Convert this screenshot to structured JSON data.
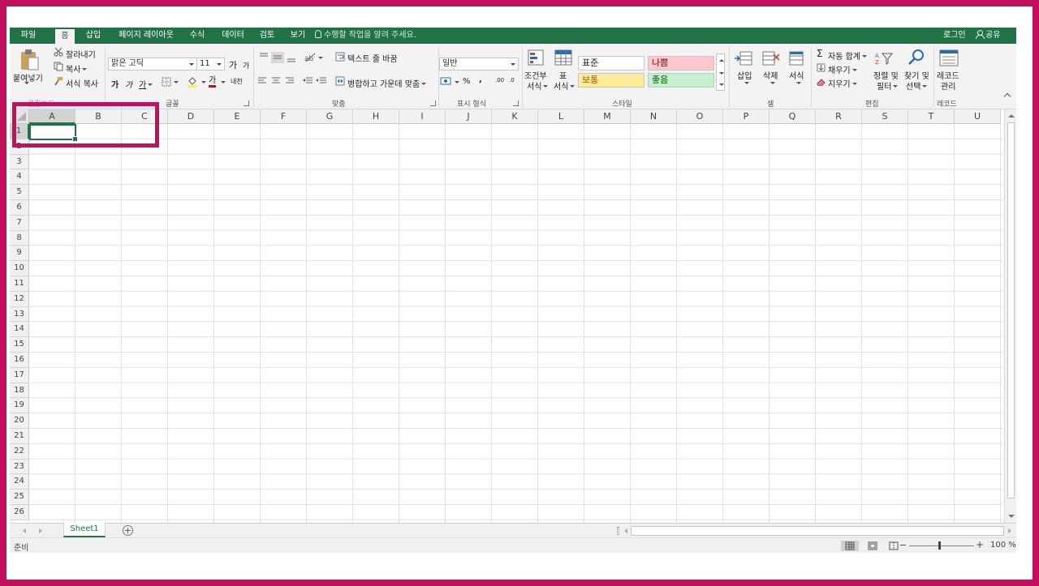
{
  "tabs": {
    "file": "파일",
    "home": "홈",
    "insert": "삽입",
    "layout": "페이지 레이아웃",
    "formulas": "수식",
    "data": "데이터",
    "review": "검토",
    "view": "보기",
    "tell_me": "수행할 작업을 알려 주세요.",
    "login": "로그인",
    "share": "공유"
  },
  "clipboard": {
    "paste": "붙여넣기",
    "cut": "잘라내기",
    "copy": "복사",
    "format_painter": "서식 복사",
    "label": "클립보드"
  },
  "font": {
    "name": "맑은 고딕",
    "size": "11",
    "grow": "가",
    "shrink": "가",
    "bold": "가",
    "italic": "가",
    "underline": "가",
    "color_letter": "가",
    "phonetic": "내천",
    "label": "글꼴"
  },
  "alignment": {
    "wrap_text": "텍스트 줄 바꿈",
    "merge_center": "병합하고 가운데 맞춤",
    "label": "맞춤"
  },
  "number": {
    "format": "일반",
    "percent": "%",
    "comma": ",",
    "inc_dec": ".00",
    "dec_dec": ".0",
    "label": "표시 형식"
  },
  "styles": {
    "conditional_1": "조건부",
    "conditional_2": "서식",
    "table_1": "표",
    "table_2": "서식",
    "normal": "표준",
    "bad": "나쁨",
    "neutral": "보통",
    "good": "좋음",
    "label": "스타일"
  },
  "cells": {
    "insert": "삽입",
    "delete": "삭제",
    "format": "서식",
    "label": "셀"
  },
  "editing": {
    "autosum": "자동 합계",
    "fill": "채우기",
    "clear": "지우기",
    "sort_1": "정렬 및",
    "sort_2": "필터",
    "find_1": "찾기 및",
    "find_2": "선택",
    "label": "편집"
  },
  "records": {
    "btn_1": "레코드",
    "btn_2": "관리",
    "label": "레코드"
  },
  "columns": [
    "A",
    "B",
    "C",
    "D",
    "E",
    "F",
    "G",
    "H",
    "I",
    "J",
    "K",
    "L",
    "M",
    "N",
    "O",
    "P",
    "Q",
    "R",
    "S",
    "T",
    "U"
  ],
  "rows": [
    "1",
    "2",
    "3",
    "4",
    "5",
    "6",
    "7",
    "8",
    "9",
    "10",
    "11",
    "12",
    "13",
    "14",
    "15",
    "16",
    "17",
    "18",
    "19",
    "20",
    "21",
    "22",
    "23",
    "24",
    "25",
    "26"
  ],
  "sheet": {
    "tab": "Sheet1",
    "add": "+"
  },
  "status": {
    "ready": "준비",
    "zoom": "100 %",
    "minus": "−",
    "plus": "+"
  },
  "colors": {
    "brand": "#217346",
    "highlight": "#c2105e",
    "bad_bg": "#ffc7ce",
    "bad_fg": "#9c0006",
    "neutral_bg": "#ffeb9c",
    "neutral_fg": "#9c5700",
    "good_bg": "#c6efce",
    "good_fg": "#006100"
  }
}
